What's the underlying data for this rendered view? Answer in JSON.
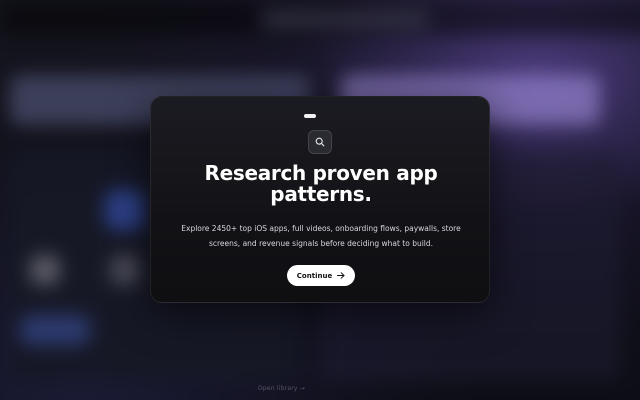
{
  "background": {
    "footer_text": "Open library →"
  },
  "modal": {
    "icon": "search-icon",
    "title": "Research proven app patterns.",
    "description": "Explore 2450+ top iOS apps, full videos, onboarding flows, paywalls, store screens, and revenue signals before deciding what to build.",
    "continue_label": "Continue",
    "continue_icon": "arrow-right-icon",
    "progress_step": 1
  },
  "colors": {
    "modal_bg": "#121216",
    "button_bg": "#ffffff",
    "accent_glow": "#7a5ac8"
  }
}
